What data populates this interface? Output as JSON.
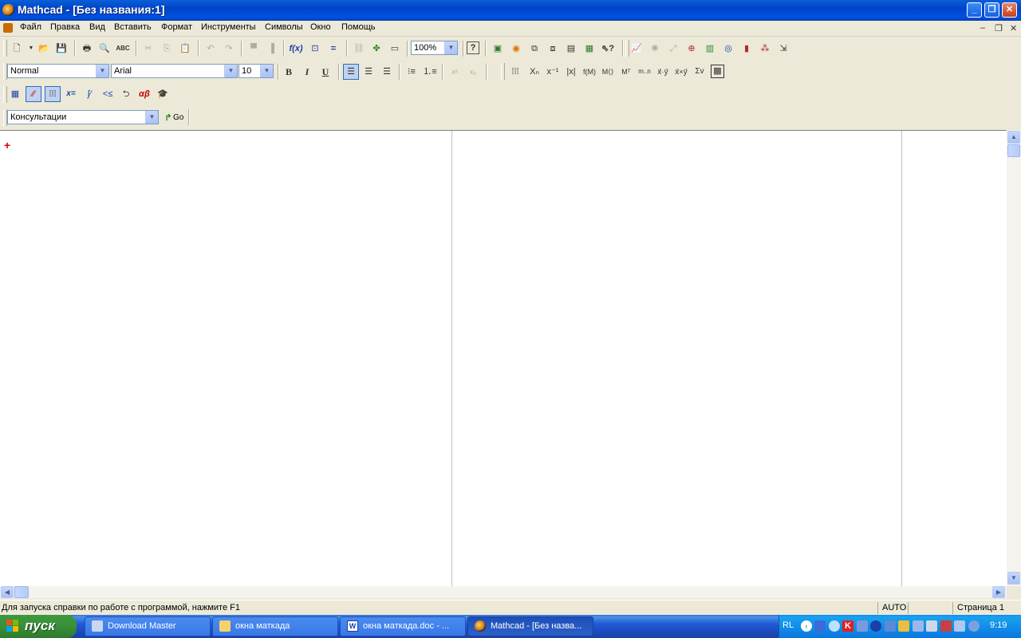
{
  "window": {
    "title": "Mathcad - [Без названия:1]",
    "controls": {
      "minimize": "_",
      "restore": "❐",
      "close": "✕"
    }
  },
  "menu": {
    "items": [
      "Файл",
      "Правка",
      "Вид",
      "Вставить",
      "Формат",
      "Инструменты",
      "Символы",
      "Окно",
      "Помощь"
    ],
    "mdi_controls": {
      "minimize": "–",
      "restore": "❐",
      "close": "✕"
    }
  },
  "standard_toolbar": {
    "zoom": "100%"
  },
  "formatting_toolbar": {
    "style": "Normal",
    "font": "Arial",
    "size": "10",
    "bold": "B",
    "italic": "I",
    "underline": "U"
  },
  "resources_toolbar": {
    "selected": "Консультации",
    "go_label": "Go"
  },
  "status": {
    "help_text": "Для запуска справки по работе с программой, нажмите F1",
    "mode": "AUTO",
    "page": "Страница 1"
  },
  "taskbar": {
    "start_label": "пуск",
    "tasks": [
      {
        "label": "Download Master"
      },
      {
        "label": "окна маткада"
      },
      {
        "label": "окна маткада.doc - ..."
      },
      {
        "label": "Mathcad - [Без назва..."
      }
    ],
    "tray": {
      "lang": "RL",
      "clock": "9:19"
    }
  },
  "colors": {
    "titlebar": "#0054e3",
    "taskbar": "#245edb",
    "start": "#3a8f3a",
    "cursor": "#e00000"
  }
}
